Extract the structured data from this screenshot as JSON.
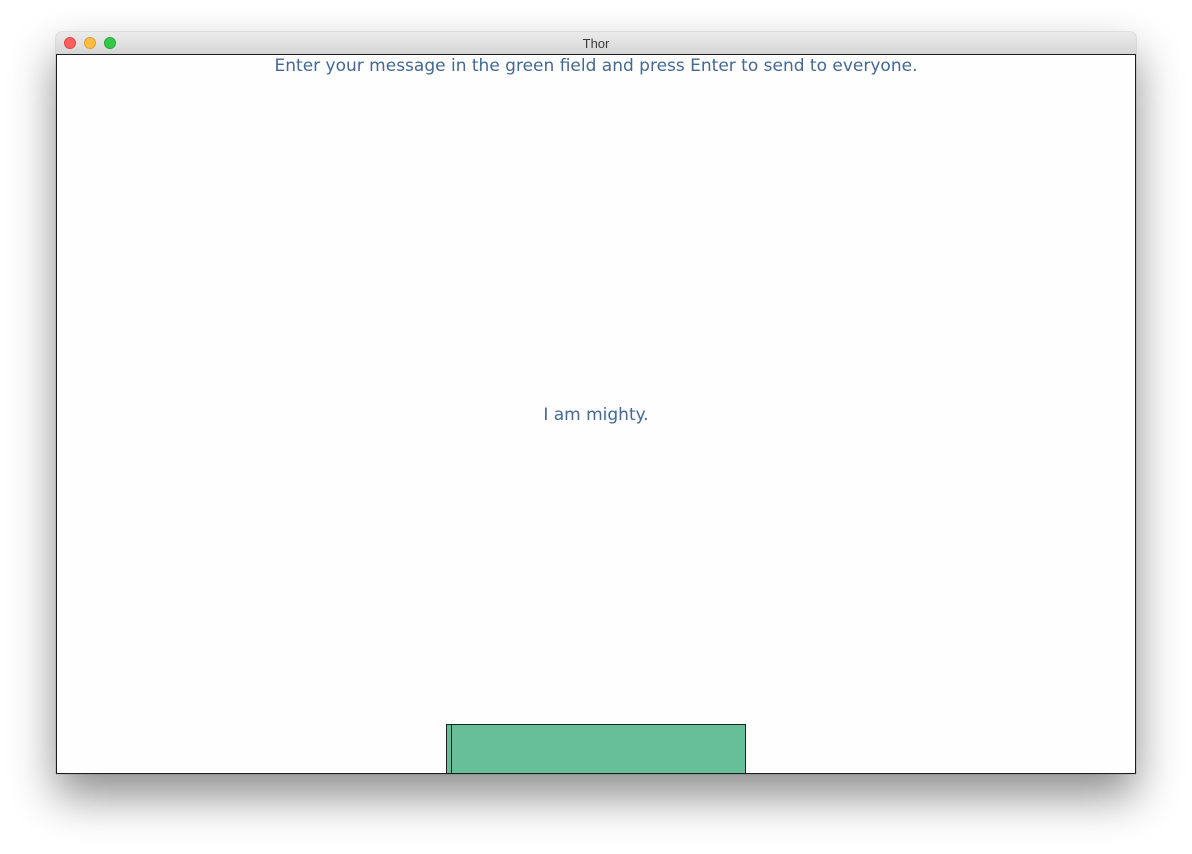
{
  "window": {
    "title": "Thor"
  },
  "main": {
    "instructions": "Enter your message in the green field and press Enter to send to everyone.",
    "message": "I am mighty."
  },
  "input": {
    "value": "",
    "color": "#66bf98"
  },
  "colors": {
    "text": "#436893",
    "close": "#fc605c",
    "minimize": "#fdbc40",
    "maximize": "#34c84a"
  }
}
